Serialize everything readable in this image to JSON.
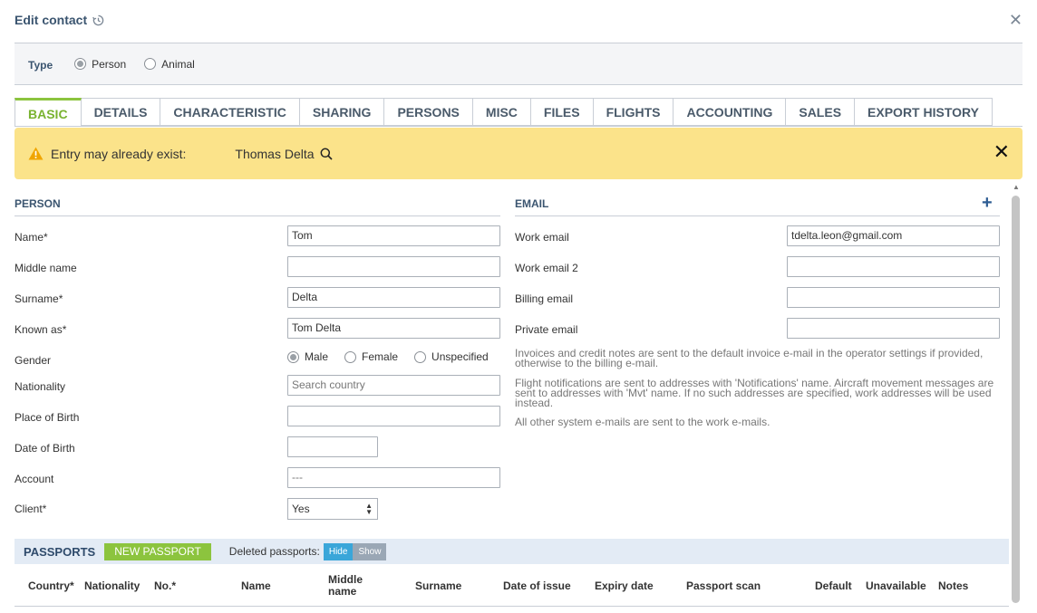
{
  "header": {
    "title": "Edit contact",
    "history_icon": "history-icon",
    "close_icon": "close-icon"
  },
  "type": {
    "label": "Type",
    "options": [
      {
        "label": "Person",
        "checked": true
      },
      {
        "label": "Animal",
        "checked": false
      }
    ]
  },
  "tabs": [
    "BASIC",
    "DETAILS",
    "CHARACTERISTIC",
    "SHARING",
    "PERSONS",
    "MISC",
    "FILES",
    "FLIGHTS",
    "ACCOUNTING",
    "SALES",
    "EXPORT HISTORY"
  ],
  "alert": {
    "message": "Entry may already exist:",
    "match": "Thomas Delta",
    "color": "#fbe38a"
  },
  "person": {
    "title": "PERSON",
    "name_label": "Name*",
    "name_value": "Tom",
    "middle_label": "Middle name",
    "middle_value": "",
    "surname_label": "Surname*",
    "surname_value": "Delta",
    "known_label": "Known as*",
    "known_value": "Tom Delta",
    "gender_label": "Gender",
    "gender_options": [
      {
        "label": "Male",
        "checked": true
      },
      {
        "label": "Female",
        "checked": false
      },
      {
        "label": "Unspecified",
        "checked": false
      }
    ],
    "nationality_label": "Nationality",
    "nationality_placeholder": "Search country",
    "pob_label": "Place of Birth",
    "pob_value": "",
    "dob_label": "Date of Birth",
    "dob_value": "",
    "account_label": "Account",
    "account_value": "---",
    "client_label": "Client*",
    "client_value": "Yes"
  },
  "email": {
    "title": "EMAIL",
    "work_label": "Work email",
    "work_value": "tdelta.leon@gmail.com",
    "work2_label": "Work email 2",
    "work2_value": "",
    "billing_label": "Billing email",
    "billing_value": "",
    "private_label": "Private email",
    "private_value": "",
    "note1": "Invoices and credit notes are sent to the default invoice e-mail in the operator settings if provided, otherwise to the billing e-mail.",
    "note2": "Flight notifications are sent to addresses with 'Notifications' name. Aircraft movement messages are sent to addresses with 'Mvt' name. If no such addresses are specified, work addresses will be used instead.",
    "note3": "All other system e-mails are sent to the work e-mails."
  },
  "passports": {
    "title": "PASSPORTS",
    "new_button": "NEW PASSPORT",
    "deleted_label": "Deleted passports:",
    "hide": "Hide",
    "show": "Show",
    "columns": [
      "Country*",
      "Nationality",
      "No.*",
      "Name",
      "Middle name",
      "Surname",
      "Date of issue",
      "Expiry date",
      "Passport scan",
      "Default",
      "Unavailable",
      "Notes"
    ]
  },
  "colors": {
    "accent": "#8cc43e",
    "title": "#3b5570",
    "toggle_hide": "#3aa6d9"
  }
}
